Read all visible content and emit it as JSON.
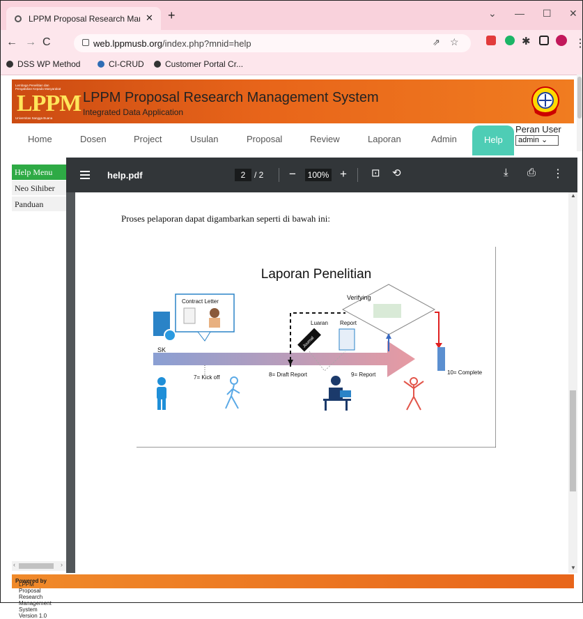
{
  "browser": {
    "tab_title": "LPPM Proposal Research Manage",
    "tab_close": "✕",
    "new_tab": "+",
    "url_host": "web.lppmusb.org",
    "url_path": "/index.php?mnid=help",
    "bookmarks": [
      "DSS WP Method",
      "CI-CRUD",
      "Customer Portal Cr..."
    ],
    "controls": {
      "minimize": "—",
      "maximize": "☐",
      "close": "✕",
      "chevron": "⌄"
    }
  },
  "site": {
    "logo_text": "LPPM",
    "logo_caption": "Lembaga Penelitian dan Pengabdian Kepada Masyarakat",
    "logo_footer": "Universitas Sangga Buana",
    "title": "LPPM Proposal Research Management System",
    "subtitle": "Integrated Data Application"
  },
  "menu": {
    "items": [
      "Home",
      "Dosen",
      "Project",
      "Usulan",
      "Proposal",
      "Review",
      "Laporan",
      "Admin"
    ],
    "active": "Help",
    "role_label": "Peran User",
    "role_value": "admin"
  },
  "sidebar": {
    "header": "Help Menu",
    "items": [
      "Neo Sihiber",
      "Panduan"
    ]
  },
  "pdf": {
    "filename": "help.pdf",
    "current_page": "2",
    "total_pages": "/ 2",
    "zoom": "100%",
    "intro_text": "Proses pelaporan dapat digambarkan seperti di bawah ini:",
    "diagram": {
      "title": "Laporan Penelitian",
      "contract_letter": "Contract Letter",
      "sk": "SK",
      "verifying": "Verifying",
      "luaran": "Luaran",
      "report": "Report",
      "journal": "Journal",
      "kick_off": "7= Kick off",
      "draft_report": "8= Draft Report",
      "report_step": "9= Report",
      "complete": "10= Complete"
    }
  },
  "footer": {
    "powered_by": "Powered by",
    "text": "LPPM Proposal Research Management System Version 1.0"
  }
}
